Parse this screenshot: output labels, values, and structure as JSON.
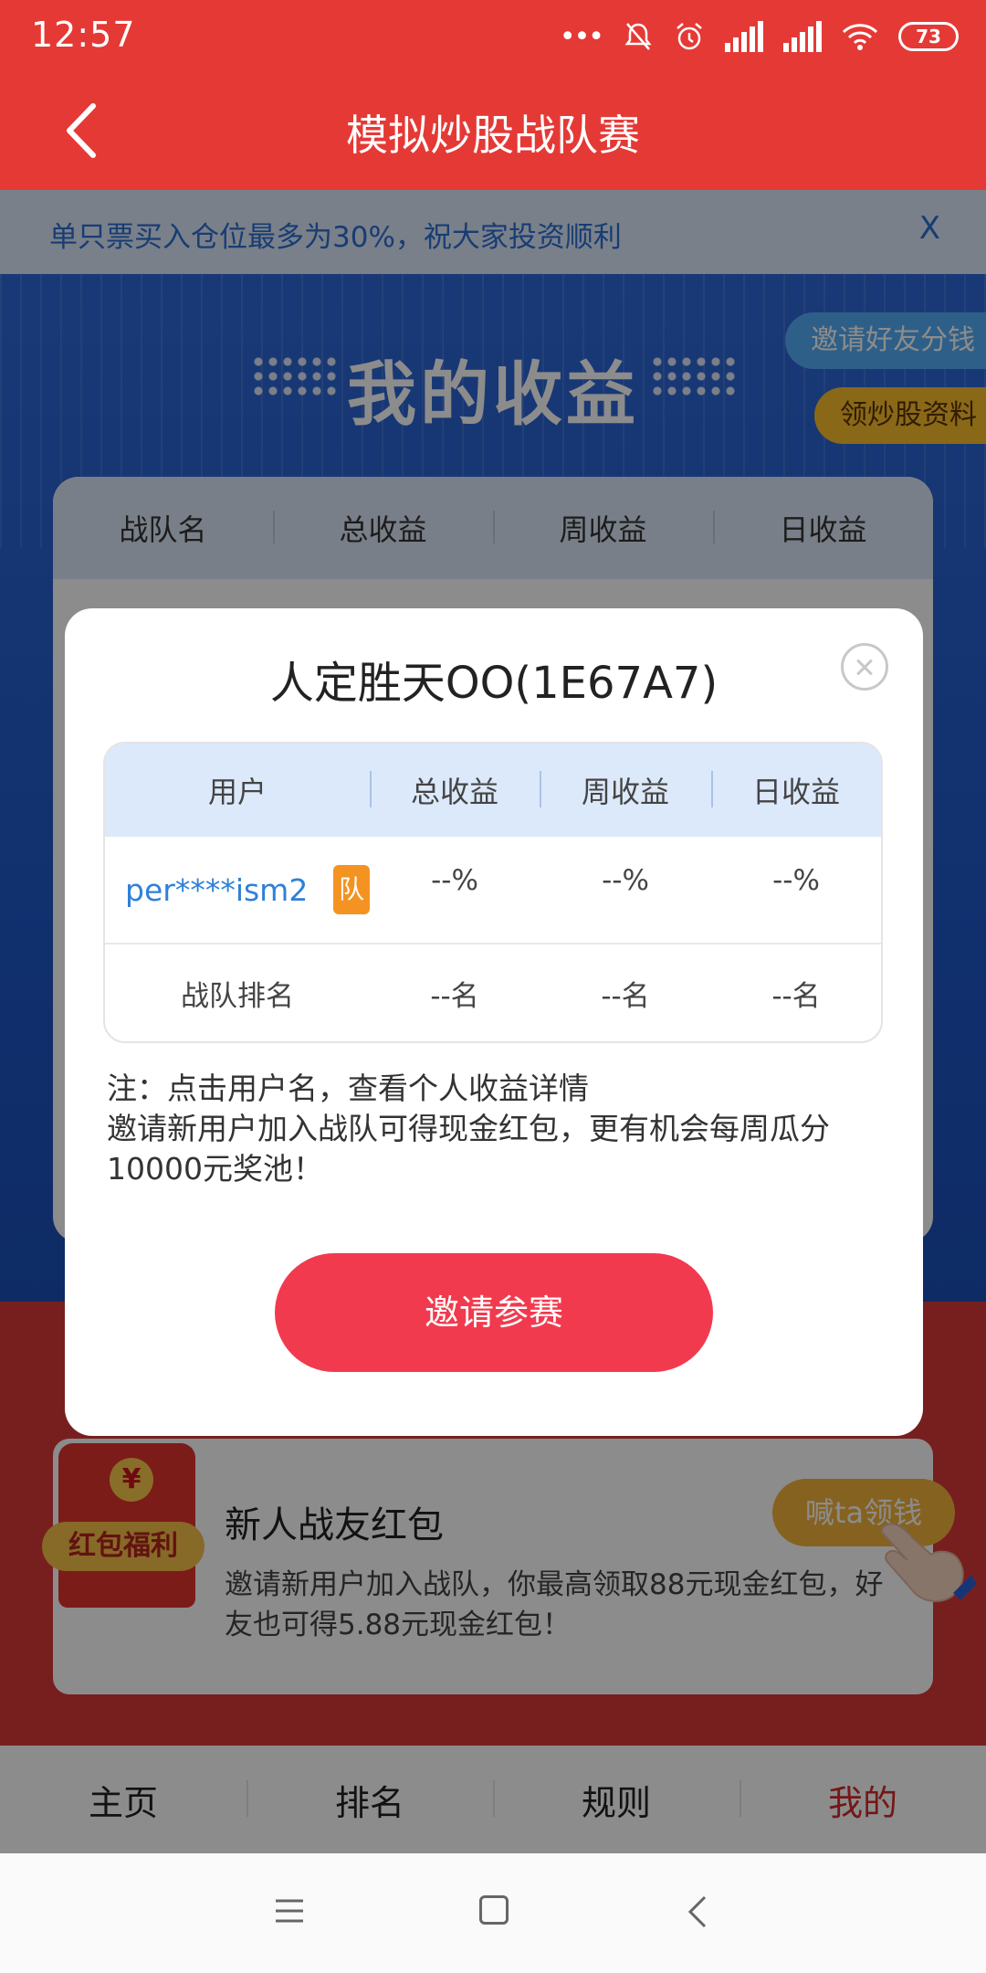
{
  "status_bar": {
    "time": "12:57",
    "battery": "73"
  },
  "header": {
    "title": "模拟炒股战队赛"
  },
  "notice": {
    "text": "单只票买入仓位最多为30%，祝大家投资顺利",
    "close": "X"
  },
  "hero": {
    "title": "我的收益",
    "invite_pill": "邀请好友分钱",
    "material_pill": "领炒股资料"
  },
  "team_table": {
    "headers": [
      "战队名",
      "总收益",
      "周收益",
      "日收益"
    ]
  },
  "promo": {
    "badge": "红包福利",
    "coin": "¥",
    "title": "新人战友红包",
    "desc": "邀请新用户加入战队，你最高领取88元现金红包，好友也可得5.88元现金红包！",
    "button": "喊ta领钱"
  },
  "tabs": [
    "主页",
    "排名",
    "规则",
    "我的"
  ],
  "modal": {
    "title": "人定胜天OO(1E67A7)",
    "headers": [
      "用户",
      "总收益",
      "周收益",
      "日收益"
    ],
    "user": {
      "name": "per****ism2",
      "badge": "队",
      "total": "--%",
      "week": "--%",
      "day": "--%"
    },
    "rank": {
      "label": "战队排名",
      "total": "--名",
      "week": "--名",
      "day": "--名"
    },
    "note_line1": "注：点击用户名，查看个人收益详情",
    "note_line2": "邀请新用户加入战队可得现金红包，更有机会每周瓜分10000元奖池！",
    "invite_button": "邀请参赛"
  },
  "colors": {
    "brand_red": "#e53935",
    "link_blue": "#2f80d8",
    "button_red": "#f23a4e",
    "badge_orange": "#f59322"
  }
}
